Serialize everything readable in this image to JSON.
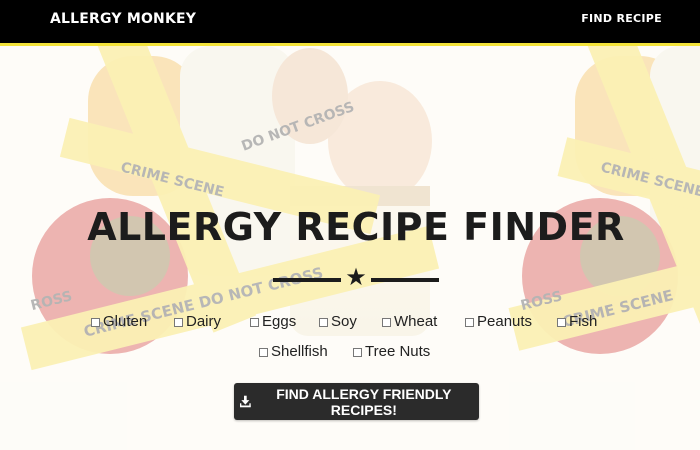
{
  "navbar": {
    "brand": "ALLERGY MONKEY",
    "find_recipe_link": "FIND RECIPE"
  },
  "hero": {
    "title": "ALLERGY RECIPE FINDER",
    "divider_icon": "star-icon",
    "background_tape_text": [
      "CRIME SCENE",
      "DO NOT CROSS",
      "CRIME SCENE DO NOT CROSS",
      "ROSS"
    ]
  },
  "allergens": [
    {
      "label": "Gluten",
      "checked": false
    },
    {
      "label": "Dairy",
      "checked": false
    },
    {
      "label": "Eggs",
      "checked": false
    },
    {
      "label": "Soy",
      "checked": false
    },
    {
      "label": "Wheat",
      "checked": false
    },
    {
      "label": "Peanuts",
      "checked": false
    },
    {
      "label": "Fish",
      "checked": false
    },
    {
      "label": "Shellfish",
      "checked": false
    },
    {
      "label": "Tree Nuts",
      "checked": false
    }
  ],
  "search_button": {
    "label": "FIND ALLERGY FRIENDLY RECIPES!",
    "icon": "download-icon"
  },
  "colors": {
    "navbar_bg": "#000000",
    "navbar_accent": "#f3e33a",
    "button_bg": "#2b2b2b",
    "text_dark": "#1c1c1c"
  }
}
